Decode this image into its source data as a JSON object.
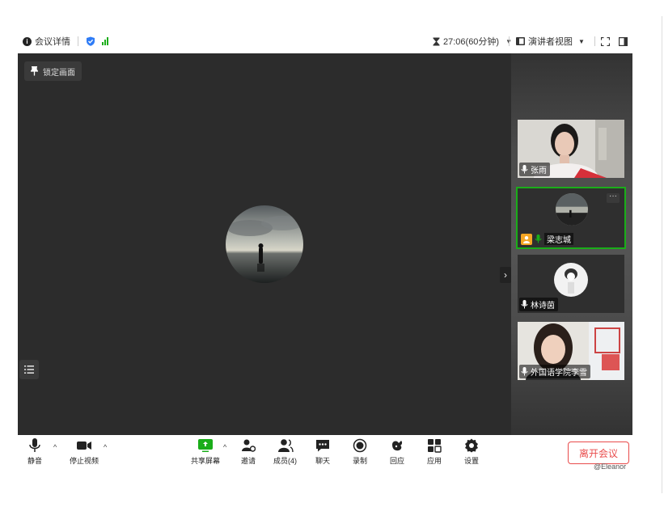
{
  "topbar": {
    "meeting_details": "会议详情",
    "timer": "27:06(60分钟)",
    "view_mode": "演讲者视图"
  },
  "stage": {
    "lock_label": "锁定画面"
  },
  "participants": [
    {
      "name": "张雨"
    },
    {
      "name": "梁志城"
    },
    {
      "name": "林诗茵"
    },
    {
      "name": "外国语学院李雪"
    }
  ],
  "toolbar": {
    "mute": "静音",
    "stop_video": "停止视频",
    "share_screen": "共享屏幕",
    "invite": "邀请",
    "members": "成员(4)",
    "chat": "聊天",
    "record": "录制",
    "reactions": "回应",
    "apps": "应用",
    "settings": "设置",
    "leave": "离开会议"
  },
  "watermark": "@Eleanor",
  "colors": {
    "accent": "#1aad19",
    "leave": "#e94b4b",
    "stage_bg": "#2c2c2c"
  },
  "icons": [
    "info-icon",
    "shield-icon",
    "signal-icon",
    "hourglass-icon",
    "dropdown-icon",
    "layout-icon",
    "fullscreen-icon",
    "sidebar-toggle-icon",
    "pin-icon",
    "list-icon",
    "chevron-right-icon",
    "mic-icon",
    "camera-icon",
    "share-screen-icon",
    "invite-icon",
    "members-icon",
    "chat-icon",
    "record-icon",
    "reaction-icon",
    "apps-icon",
    "gear-icon"
  ]
}
